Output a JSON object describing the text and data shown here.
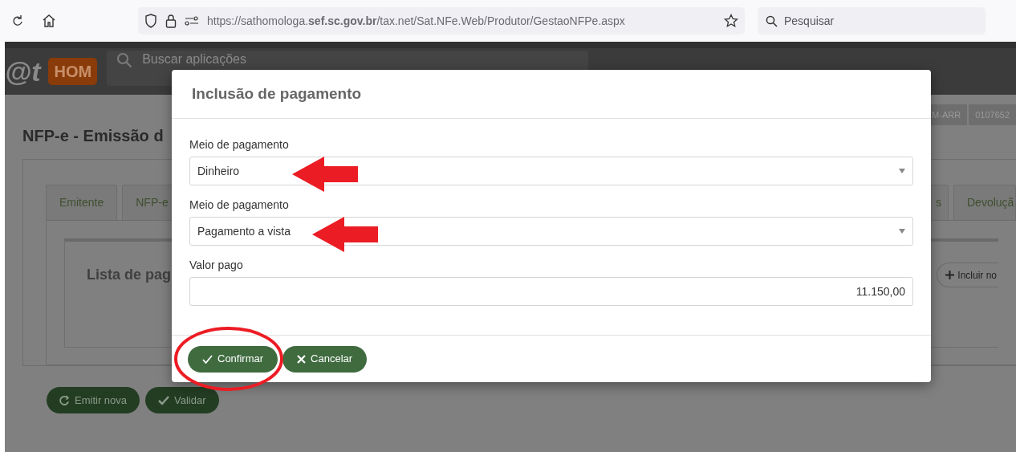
{
  "browser": {
    "url": "https://sathomologa.**sef.sc.gov.br**/tax.net/Sat.NFe.Web/Produtor/GestaoNFPe.aspx",
    "search_placeholder": "Pesquisar"
  },
  "app_header": {
    "logo": "@t",
    "environment_badge": "HOM",
    "search_placeholder": "Buscar aplicações"
  },
  "page": {
    "title": "NFP-e - Emissão d",
    "user_badges": [
      "M-ARR",
      "0107652"
    ],
    "tabs": [
      {
        "label": "Emitente"
      },
      {
        "label": "NFP-e"
      },
      {
        "label": "s"
      },
      {
        "label": "Devoluçã"
      }
    ],
    "panel_title": "Lista de pag",
    "add_button": "Incluir no",
    "actions": [
      {
        "kind": "refresh",
        "label": "Emitir nova"
      },
      {
        "kind": "check",
        "label": "Validar"
      }
    ]
  },
  "modal": {
    "title": "Inclusão de pagamento",
    "fields": [
      {
        "kind": "select",
        "label": "Meio de pagamento",
        "value": "Dinheiro"
      },
      {
        "kind": "select",
        "label": "Meio de pagamento",
        "value": "Pagamento a vista"
      },
      {
        "kind": "input",
        "label": "Valor pago",
        "value": "11.150,00"
      }
    ],
    "buttons": [
      {
        "kind": "confirm",
        "label": "Confirmar"
      },
      {
        "kind": "cancel",
        "label": "Cancelar"
      }
    ]
  }
}
